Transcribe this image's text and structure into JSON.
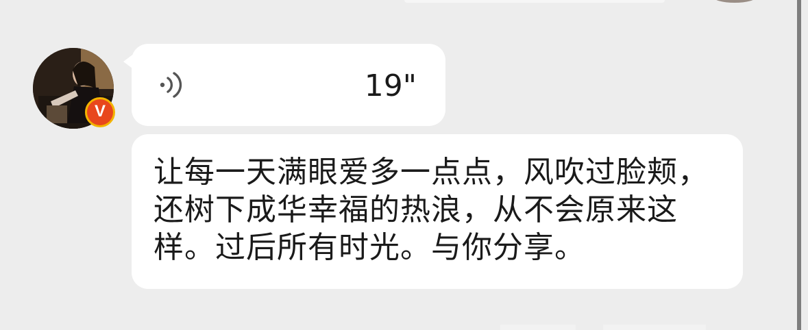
{
  "chat": {
    "sender": {
      "avatar_icon": "profile-photo",
      "verified_badge": "V"
    },
    "voice_message": {
      "icon": "voice-wave-icon",
      "duration": "19\""
    },
    "text_message": {
      "text": "让每一天满眼爱多一点点，风吹过脸颊，还树下成华幸福的热浪，从不会原来这样。过后所有时光。与你分享。"
    }
  },
  "colors": {
    "background": "#ededed",
    "bubble": "#ffffff",
    "badge_outer": "#f3b400",
    "badge_inner": "#e8471d"
  }
}
